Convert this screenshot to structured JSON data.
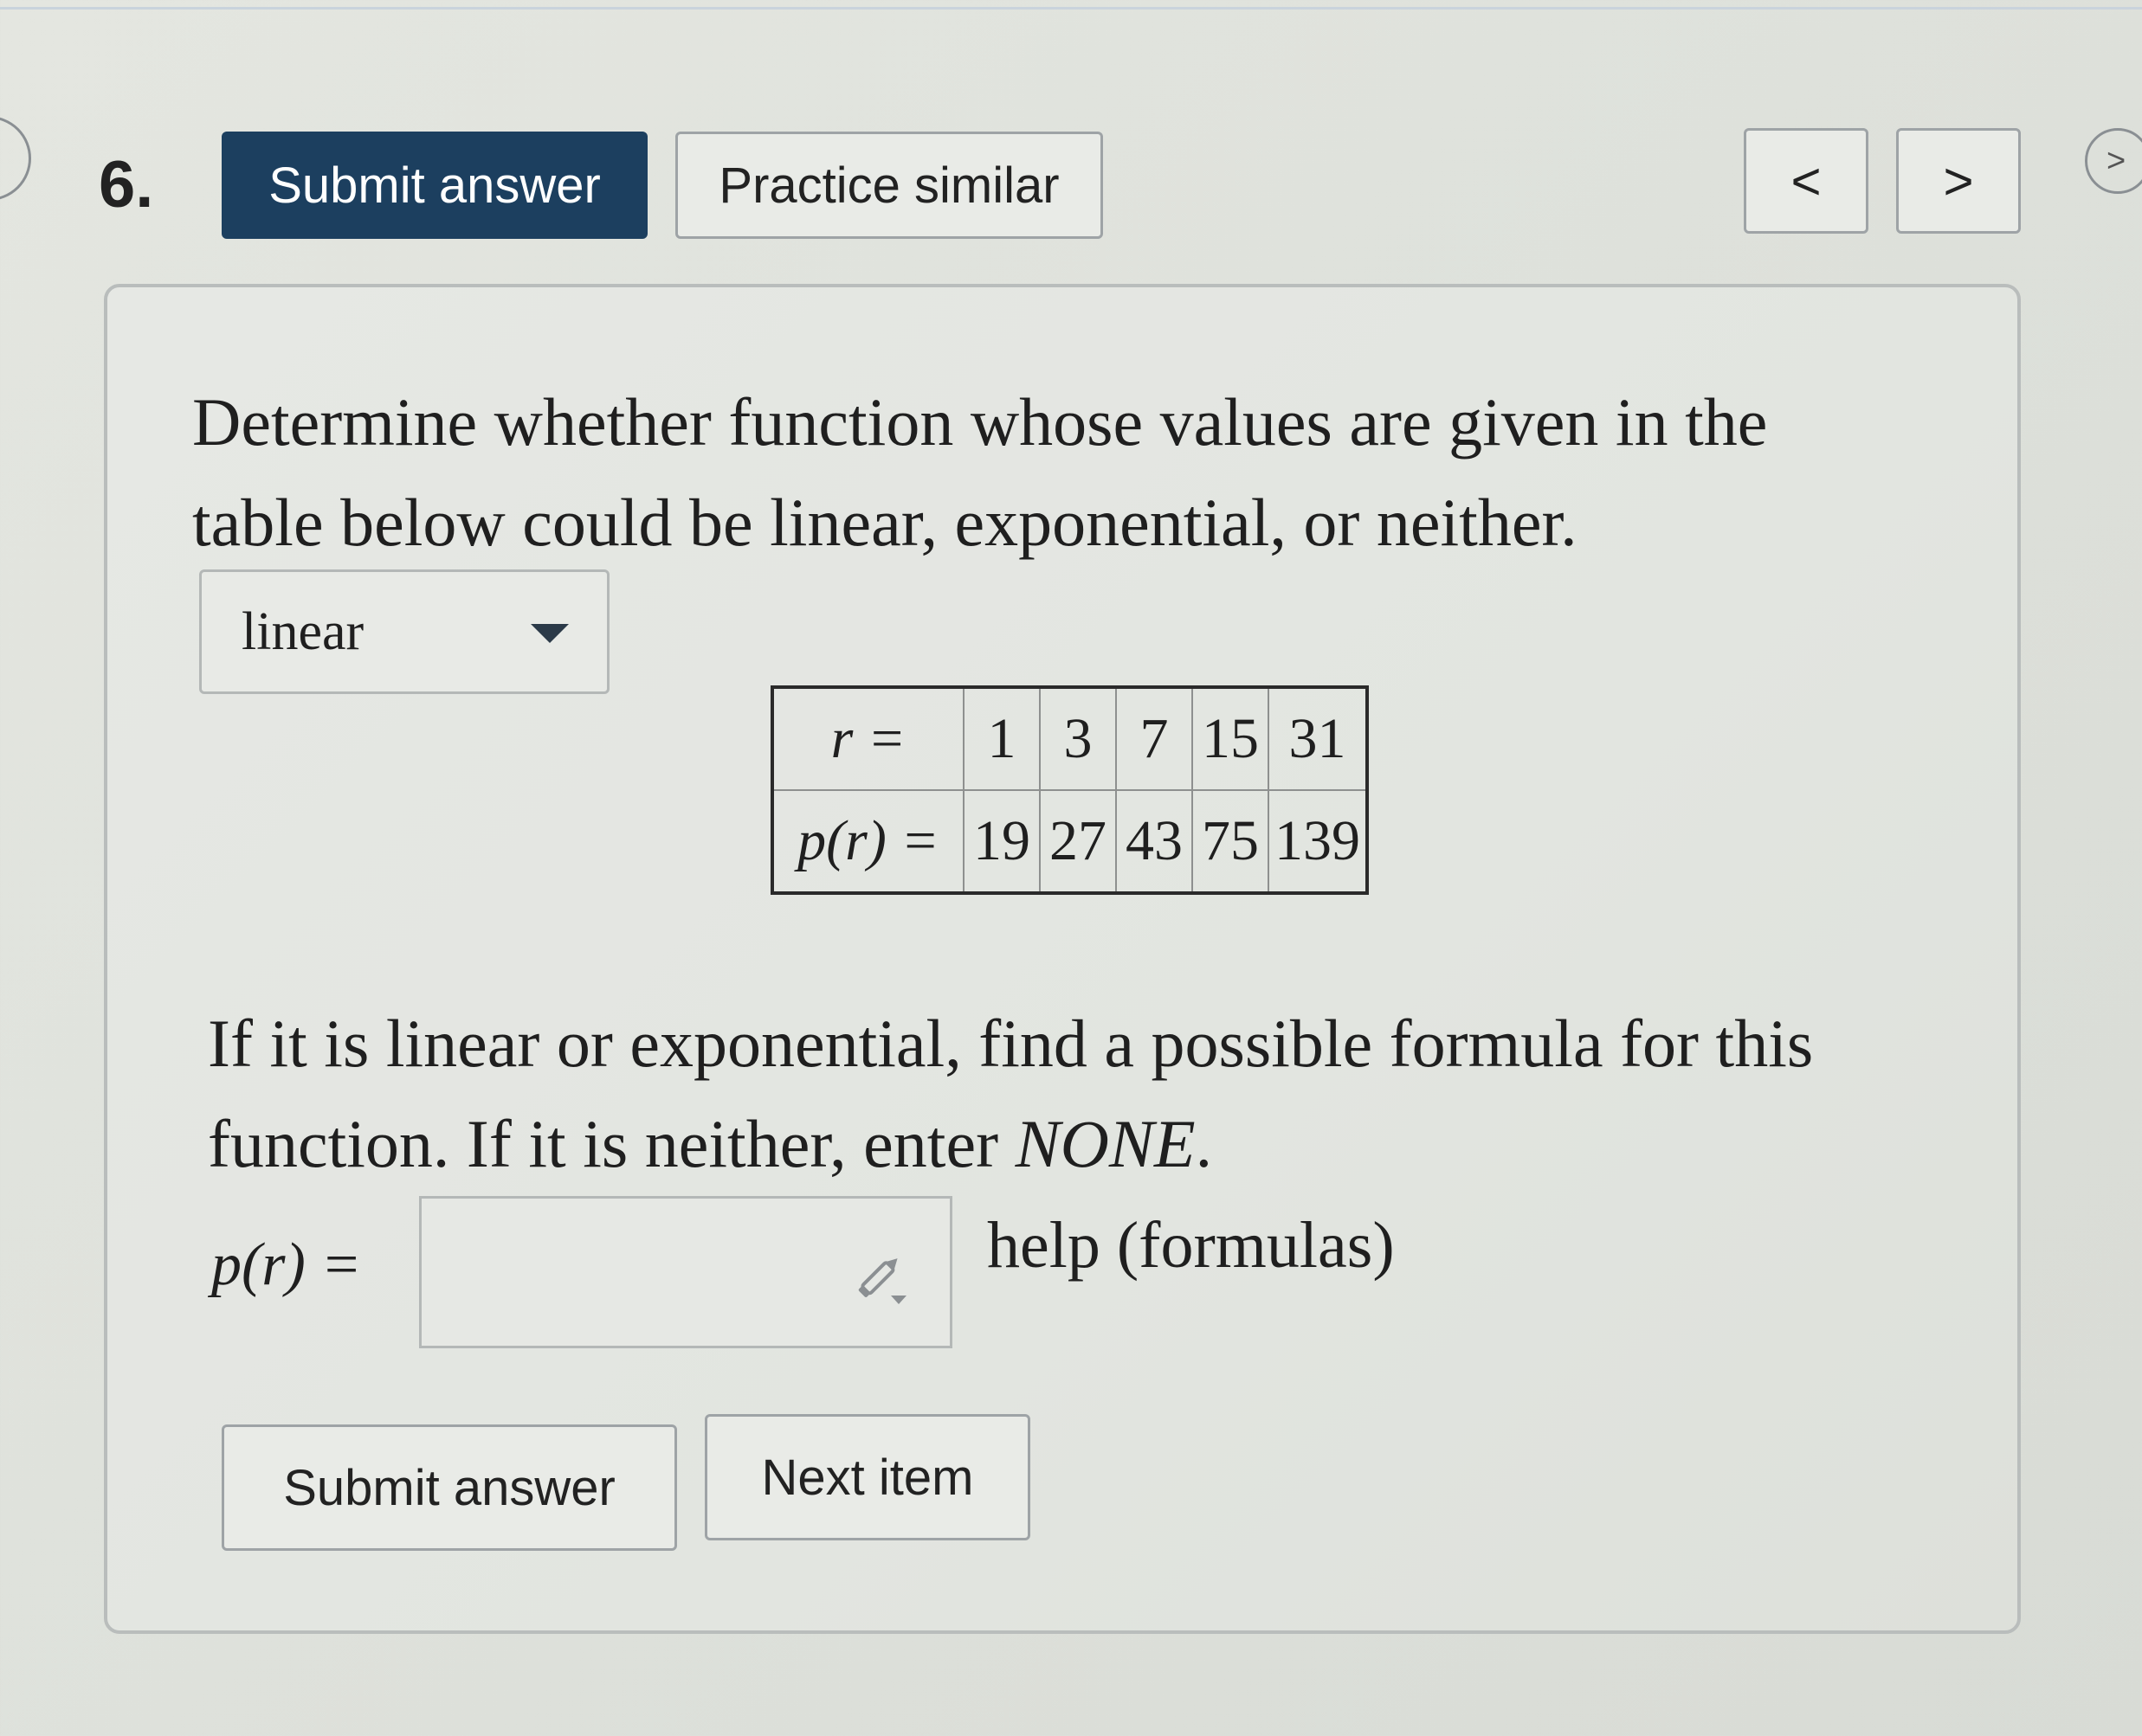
{
  "header": {
    "question_number": "6.",
    "submit_label": "Submit answer",
    "practice_label": "Practice similar",
    "prev_icon": "chevron-left-icon",
    "prev_glyph": "<",
    "next_icon": "chevron-right-icon",
    "next_glyph": ">",
    "edge_glyph": ">"
  },
  "question": {
    "prompt": "Determine whether function whose values are given in the table below could be linear, exponential, or neither.",
    "dropdown_value": "linear",
    "table": {
      "row1_header": "r =",
      "row2_header": "p(r) =",
      "r_values": [
        "1",
        "3",
        "7",
        "15",
        "31"
      ],
      "p_values": [
        "19",
        "27",
        "43",
        "75",
        "139"
      ]
    },
    "prompt2": "If it is linear or exponential, find a possible formula for this function. If it is neither, enter",
    "prompt2_italic": "NONE",
    "prompt2_end": ".",
    "answer_label": "p(r) =",
    "answer_value": "",
    "help_label": "help (formulas)"
  },
  "footer": {
    "submit_label": "Submit answer",
    "next_label": "Next item"
  },
  "colors": {
    "primary_button": "#1c3f5f",
    "background": "#e2e5e0"
  }
}
